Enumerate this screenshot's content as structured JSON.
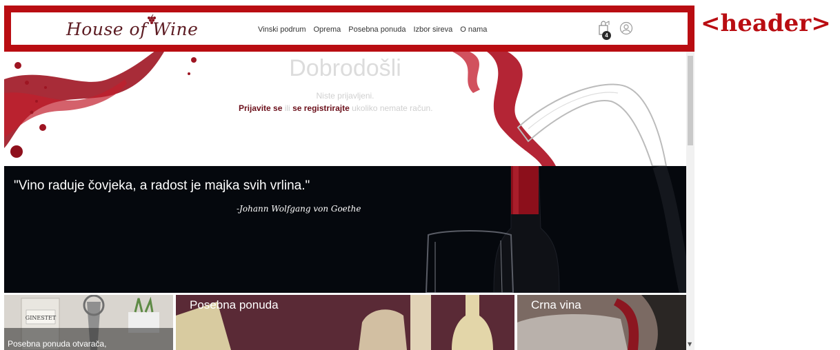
{
  "header": {
    "logo": "House of Wine",
    "nav": [
      "Vinski podrum",
      "Oprema",
      "Posebna ponuda",
      "Izbor sireva",
      "O nama"
    ],
    "cart_count": "4",
    "annotation_tag": "<header>",
    "accent_color": "#b90d12"
  },
  "hero": {
    "title": "Dobrodošli",
    "not_logged_in": "Niste prijavljeni.",
    "login_link": "Prijavite se",
    "or_text": "ili",
    "register_link": "se registrirajte",
    "register_suffix": "ukoliko nemate račun."
  },
  "quote": {
    "text": "\"Vino raduje čovjeka, a radost je majka svih vrlina.\"",
    "author": "-Johann Wolfgang von Goethe"
  },
  "tiles": [
    {
      "label": "Posebna ponuda otvarača,"
    },
    {
      "label": "Posebna ponuda"
    },
    {
      "label": "Crna vina"
    }
  ],
  "icons": {
    "logo_accent": "grape-icon",
    "cart": "shopping-bag-icon",
    "user": "user-icon"
  }
}
